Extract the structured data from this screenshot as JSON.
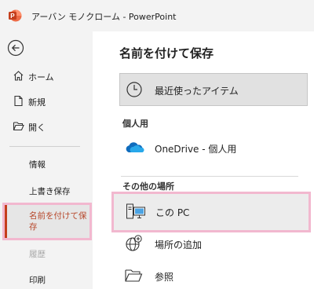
{
  "window": {
    "title": "アーバン モノクローム  -  PowerPoint"
  },
  "icons": {
    "app": "powerpoint-logo-icon",
    "back": "back-arrow-icon",
    "home": "home-icon",
    "new": "new-document-icon",
    "open": "open-folder-icon",
    "recent": "clock-icon",
    "onedrive": "onedrive-cloud-icon",
    "this_pc": "computer-icon",
    "add_place": "globe-add-icon",
    "browse": "folder-icon"
  },
  "colors": {
    "brand": "#c43e1c",
    "selected_text": "#b7472a",
    "highlight_border": "#f2b8cf",
    "onedrive": "#0f6cbd"
  },
  "sidebar": {
    "home": "ホーム",
    "new": "新規",
    "open": "開く",
    "info": "情報",
    "save": "上書き保存",
    "save_as": "名前を付けて保存",
    "history": "履歴",
    "print": "印刷"
  },
  "main": {
    "title": "名前を付けて保存",
    "recent": "最近使ったアイテム",
    "personal_header": "個人用",
    "onedrive": "OneDrive - 個人用",
    "other_header": "その他の場所",
    "this_pc": "この PC",
    "add_place": "場所の追加",
    "browse": "参照"
  }
}
